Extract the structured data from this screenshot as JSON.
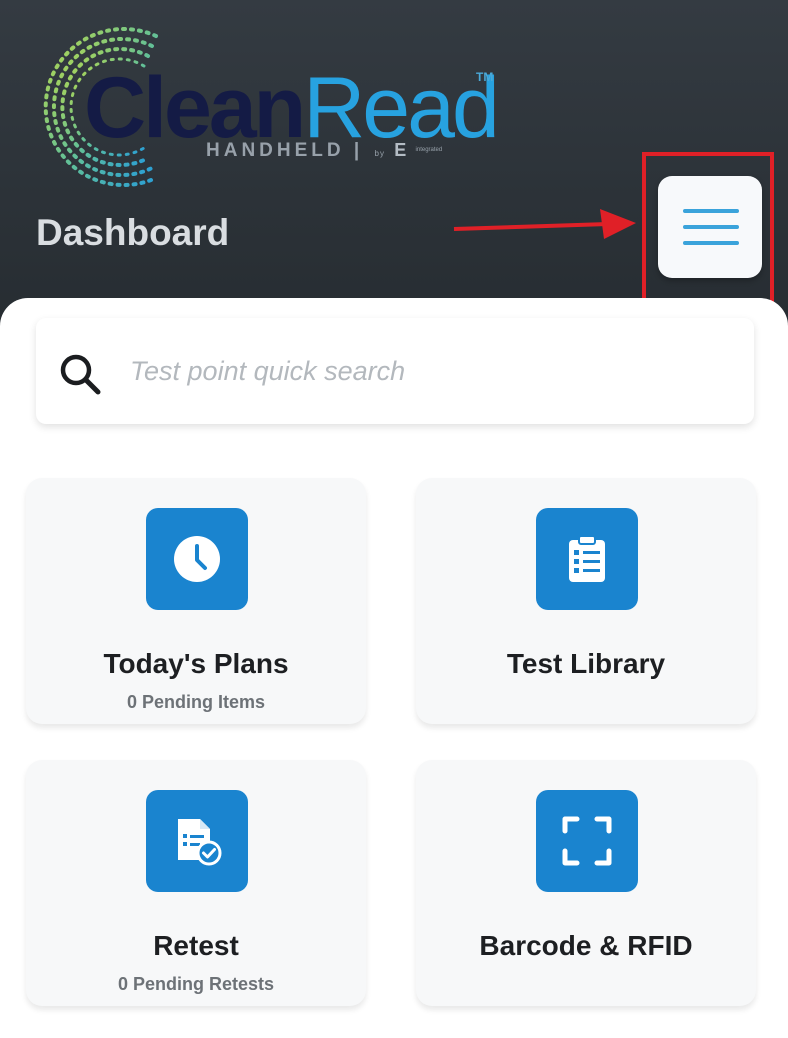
{
  "logo": {
    "word_clean": "Clean",
    "word_read": "Read",
    "trademark": "TM",
    "subtitle": "HANDHELD",
    "by": "by",
    "maker_mark": "E",
    "maker_text": "integrated"
  },
  "header": {
    "title": "Dashboard"
  },
  "menu": {
    "icon": "hamburger-menu-icon"
  },
  "annotation": {
    "arrow_color": "#e02027",
    "box_color": "#e02027"
  },
  "search": {
    "placeholder": "Test point quick search",
    "value": "",
    "icon": "search-icon"
  },
  "tiles": [
    {
      "title": "Today's Plans",
      "subtitle": "0 Pending Items",
      "icon": "clock-icon"
    },
    {
      "title": "Test Library",
      "subtitle": "",
      "icon": "clipboard-checklist-icon"
    },
    {
      "title": "Retest",
      "subtitle": "0 Pending Retests",
      "icon": "document-check-icon"
    },
    {
      "title": "Barcode & RFID",
      "subtitle": "",
      "icon": "scan-frame-icon"
    }
  ],
  "colors": {
    "header_bg": "#2c3238",
    "accent_blue": "#1a84cf",
    "menu_lines": "#3aa3db",
    "logo_dark": "#141b45",
    "logo_light": "#27a2e0"
  }
}
